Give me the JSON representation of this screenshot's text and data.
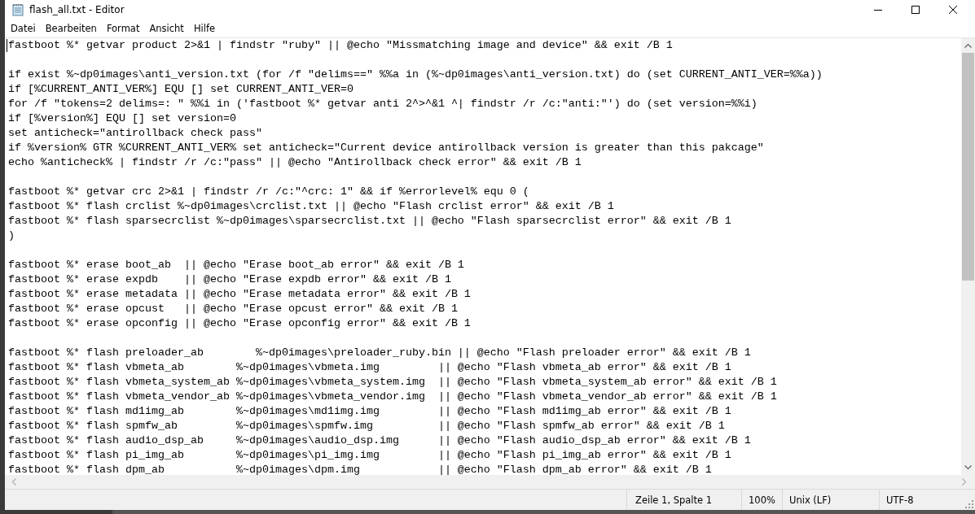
{
  "window": {
    "title": "flash_all.txt - Editor"
  },
  "menu": [
    "Datei",
    "Bearbeiten",
    "Format",
    "Ansicht",
    "Hilfe"
  ],
  "editor": {
    "blocks": [
      {
        "lines": [
          "fastboot %* getvar product 2>&1 | findstr \"ruby\" || @echo \"Missmatching image and device\" && exit /B 1"
        ]
      },
      {
        "lines": [
          "if exist %~dp0images\\anti_version.txt (for /f \"delims==\" %%a in (%~dp0images\\anti_version.txt) do (set CURRENT_ANTI_VER=%%a))",
          "if [%CURRENT_ANTI_VER%] EQU [] set CURRENT_ANTI_VER=0",
          "for /f \"tokens=2 delims=: \" %%i in ('fastboot %* getvar anti 2^>^&1 ^| findstr /r /c:\"anti:\"') do (set version=%%i)",
          "if [%version%] EQU [] set version=0",
          "set anticheck=\"antirollback check pass\"",
          "if %version% GTR %CURRENT_ANTI_VER% set anticheck=\"Current device antirollback version is greater than this pakcage\"",
          "echo %anticheck% | findstr /r /c:\"pass\" || @echo \"Antirollback check error\" && exit /B 1"
        ]
      },
      {
        "lines": [
          "fastboot %* getvar crc 2>&1 | findstr /r /c:\"^crc: 1\" && if %errorlevel% equ 0 (",
          "fastboot %* flash crclist %~dp0images\\crclist.txt || @echo \"Flash crclist error\" && exit /B 1",
          "fastboot %* flash sparsecrclist %~dp0images\\sparsecrclist.txt || @echo \"Flash sparsecrclist error\" && exit /B 1",
          ")"
        ]
      },
      {
        "lines": [
          "fastboot %* erase boot_ab  || @echo \"Erase boot_ab error\" && exit /B 1",
          "fastboot %* erase expdb    || @echo \"Erase expdb error\" && exit /B 1",
          "fastboot %* erase metadata || @echo \"Erase metadata error\" && exit /B 1",
          "fastboot %* erase opcust   || @echo \"Erase opcust error\" && exit /B 1",
          "fastboot %* erase opconfig || @echo \"Erase opconfig error\" && exit /B 1"
        ]
      },
      {
        "lines": [
          "fastboot %* flash preloader_ab        %~dp0images\\preloader_ruby.bin || @echo \"Flash preloader error\" && exit /B 1",
          "fastboot %* flash vbmeta_ab        %~dp0images\\vbmeta.img         || @echo \"Flash vbmeta_ab error\" && exit /B 1",
          "fastboot %* flash vbmeta_system_ab %~dp0images\\vbmeta_system.img  || @echo \"Flash vbmeta_system_ab error\" && exit /B 1",
          "fastboot %* flash vbmeta_vendor_ab %~dp0images\\vbmeta_vendor.img  || @echo \"Flash vbmeta_vendor_ab error\" && exit /B 1",
          "fastboot %* flash md1img_ab        %~dp0images\\md1img.img         || @echo \"Flash md1img_ab error\" && exit /B 1",
          "fastboot %* flash spmfw_ab         %~dp0images\\spmfw.img          || @echo \"Flash spmfw_ab error\" && exit /B 1",
          "fastboot %* flash audio_dsp_ab     %~dp0images\\audio_dsp.img      || @echo \"Flash audio_dsp_ab error\" && exit /B 1",
          "fastboot %* flash pi_img_ab        %~dp0images\\pi_img.img         || @echo \"Flash pi_img_ab error\" && exit /B 1",
          "fastboot %* flash dpm_ab           %~dp0images\\dpm.img            || @echo \"Flash dpm_ab error\" && exit /B 1"
        ]
      }
    ]
  },
  "status_bar": {
    "position": "Zeile 1, Spalte 1",
    "zoom": "100%",
    "line_endings": "Unix (LF)",
    "encoding": "UTF-8"
  }
}
